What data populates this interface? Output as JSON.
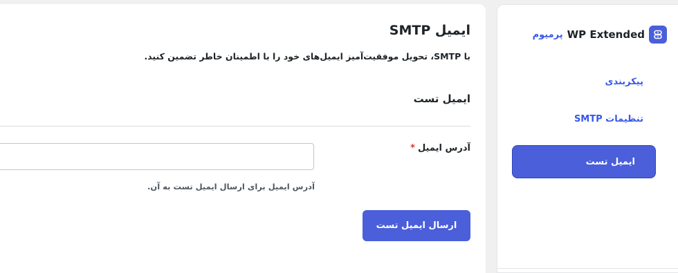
{
  "sidebar": {
    "brand_name": "WP Extended",
    "brand_badge": "پرمیوم",
    "items": [
      {
        "label": "پیکربندی"
      },
      {
        "label": "تنظیمات SMTP"
      },
      {
        "label": "ایمیل تست",
        "active": true
      }
    ]
  },
  "main": {
    "title": "ایمیل SMTP",
    "description": "با SMTP، تحویل موفقیت‌آمیز ایمیل‌های خود را با اطمینان خاطر تضمین کنید.",
    "section_title": "ایمیل تست",
    "field": {
      "label": "آدرس ایمیل",
      "required_mark": "*",
      "value": "",
      "placeholder": "",
      "help": "آدرس ایمیل برای ارسال ایمیل تست به آن."
    },
    "send_button_label": "ارسال ایمیل تست"
  },
  "colors": {
    "accent": "#4a5fd9",
    "link": "#3858e9",
    "required": "#d63638",
    "background": "#f0f0f1"
  },
  "icons": {
    "brand_logo": "wp-extended-logo-icon"
  }
}
